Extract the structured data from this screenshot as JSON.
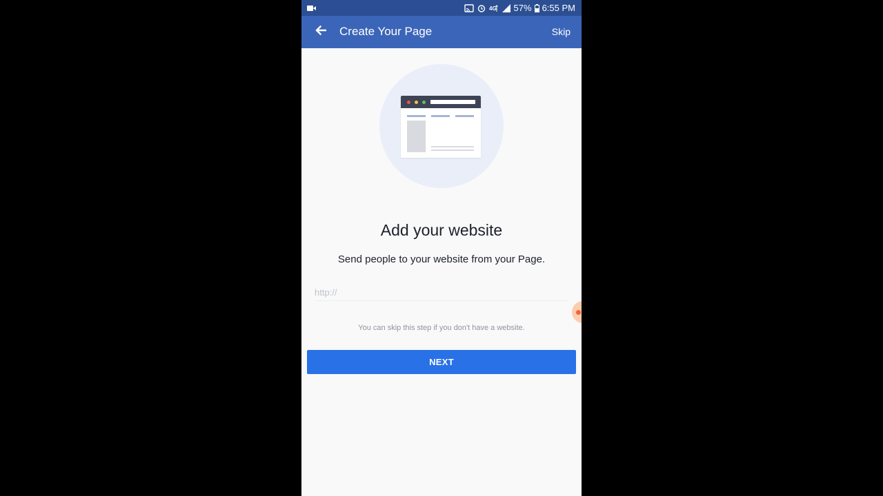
{
  "status_bar": {
    "battery": "57%",
    "time": "6:55 PM",
    "icons": [
      "video-camera-icon",
      "cast-icon",
      "alarm-icon",
      "4g-lte-icon",
      "signal-icon",
      "battery-icon"
    ]
  },
  "app_bar": {
    "title": "Create Your Page",
    "skip_label": "Skip",
    "back_icon": "arrow-left-icon"
  },
  "illustration": {
    "icon": "browser-window-illustration",
    "dot_colors": [
      "#e9574d",
      "#f6c243",
      "#5fbf6a"
    ]
  },
  "main": {
    "headline": "Add your website",
    "subtitle": "Send people to your website from your Page.",
    "url_input": {
      "placeholder": "http://",
      "value": ""
    },
    "hint": "You can skip this step if you don't have a website.",
    "next_label": "NEXT"
  },
  "colors": {
    "status_bar": "#2c4f93",
    "app_bar": "#3b65b8",
    "primary_button": "#2871e6",
    "background": "#f9f9fa"
  }
}
